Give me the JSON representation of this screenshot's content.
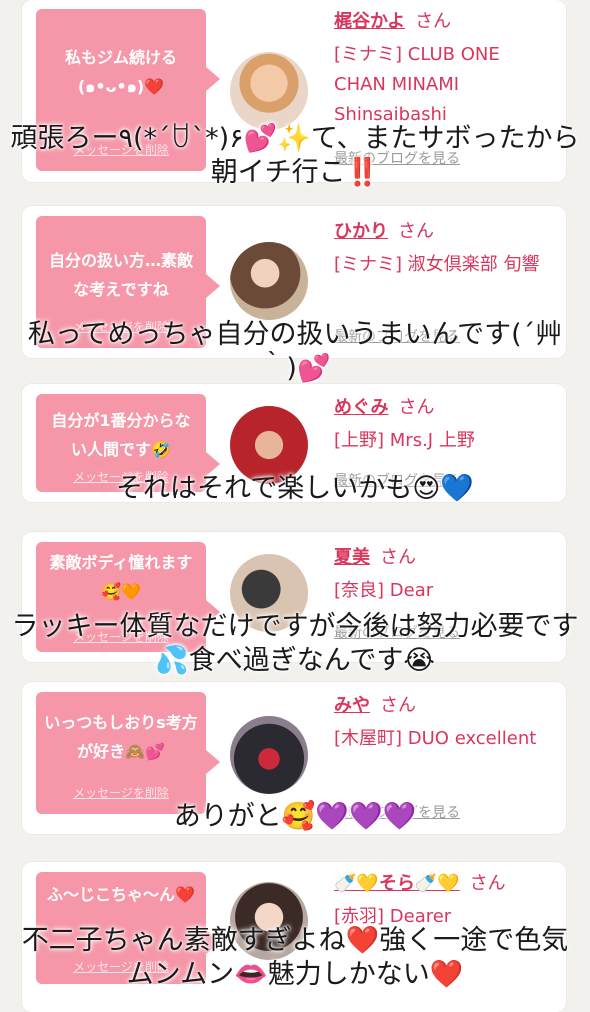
{
  "cards": [
    {
      "message": "私もジム続ける(๑•ᴗ•๑)❤️",
      "delete_label": "メッセージを削除",
      "name": "梶谷かよ",
      "honorific": "さん",
      "shop": "[ミナミ] CLUB ONE CHAN MINAMI Shinsaibashi",
      "blog_link": "最新のブログを見る"
    },
    {
      "message": "自分の扱い方…素敵な考えですね",
      "delete_label": "メッセージを削除",
      "name": "ひかり",
      "honorific": "さん",
      "shop": "[ミナミ] 淑女倶楽部 旬響",
      "blog_link": "最新のブログを見る"
    },
    {
      "message": "自分が1番分からない人間です🤣",
      "delete_label": "メッセージを削除",
      "name": "めぐみ",
      "honorific": "さん",
      "shop": "[上野] Mrs.J 上野",
      "blog_link": "最新のブログを見る"
    },
    {
      "message": "素敵ボディ憧れます🥰🧡",
      "delete_label": "メッセージを削除",
      "name": "夏美",
      "honorific": "さん",
      "shop": "[奈良] Dear",
      "blog_link": "最新のブログを見る"
    },
    {
      "message": "いっつもしおりs考方が好き🙈💕",
      "delete_label": "メッセージを削除",
      "name": "みや",
      "honorific": "さん",
      "shop": "[木屋町] DUO excellent",
      "blog_link": "最新のブログを見る"
    },
    {
      "message": "ふ〜じこちゃ〜ん❤️",
      "delete_label": "メッセージを削除",
      "name": "🍼💛そら🍼💛",
      "honorific": "さん",
      "shop": "[赤羽] Dearer",
      "blog_link": "最新のブログを見る"
    }
  ],
  "captions": [
    "頑張ろー٩(*´ꇴ`*)۶💕✨て、またサボったから朝イチ行こ‼️",
    "私ってめっちゃ自分の扱いうまいんです(´艸｀)💕",
    "それはそれで楽しいかも😍💙",
    "ラッキー体質なだけですが今後は努力必要です💦食べ過ぎなんです😭",
    "ありがと🥰💜💜💜",
    "不二子ちゃん素敵すぎよね❤️強く一途で色気ムンムン👄魅力しかない❤️"
  ],
  "colors": {
    "bubble": "#f597a8",
    "accent": "#d9365d",
    "background": "#f3f1ee"
  }
}
